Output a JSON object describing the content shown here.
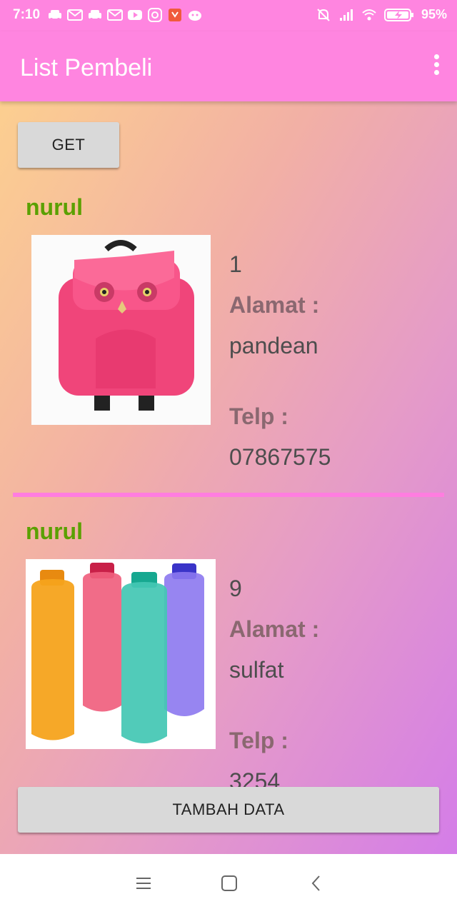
{
  "status_bar": {
    "time": "7:10",
    "battery": "95%"
  },
  "app_bar": {
    "title": "List Pembeli"
  },
  "buttons": {
    "get": "GET",
    "tambah": "TAMBAH DATA"
  },
  "items": [
    {
      "name": "nurul",
      "id": "1",
      "alamat_label": "Alamat :",
      "alamat": "pandean",
      "telp_label": "Telp :",
      "telp": "07867575"
    },
    {
      "name": "nurul",
      "id": "9",
      "alamat_label": "Alamat :",
      "alamat": "sulfat",
      "telp_label": "Telp :",
      "telp": "3254"
    }
  ],
  "colors": {
    "accent": "#ff85e0",
    "name_text": "#5aa000"
  }
}
